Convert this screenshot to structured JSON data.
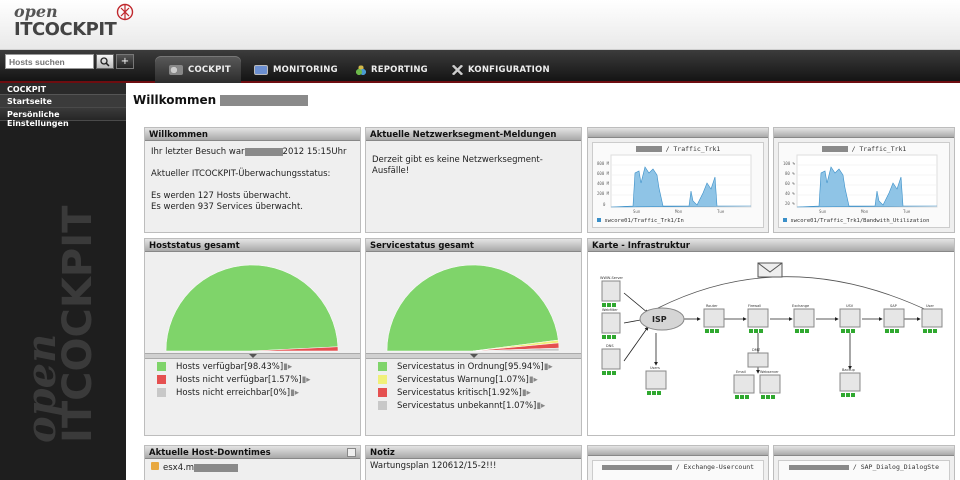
{
  "logo": {
    "open": "open",
    "itcockpit": "ITCOCKPIT"
  },
  "search": {
    "placeholder": "Hosts suchen",
    "search_icon": "search-icon",
    "add_icon": "plus-icon"
  },
  "nav": {
    "tabs": [
      {
        "label": "COCKPIT",
        "icon": "cockpit-icon"
      },
      {
        "label": "MONITORING",
        "icon": "monitor-icon"
      },
      {
        "label": "REPORTING",
        "icon": "reporting-icon"
      },
      {
        "label": "KONFIGURATION",
        "icon": "tools-icon"
      }
    ]
  },
  "sidebar": {
    "header": "COCKPIT",
    "items": [
      "Startseite",
      "Persönliche Einstellungen"
    ],
    "watermark": [
      "open",
      "ITCOCKPIT"
    ]
  },
  "page": {
    "title": "Willkommen"
  },
  "panels": {
    "welcome": {
      "title": "Willkommen",
      "last_visit_prefix": "Ihr letzter Besuch war",
      "last_visit_suffix": "2012 15:15Uhr",
      "status_heading": "Aktueller ITCOCKPIT-Überwachungsstatus:",
      "hosts_line": "Es werden 127 Hosts überwacht.",
      "services_line": "Es werden 937 Services überwacht."
    },
    "network": {
      "title": "Aktuelle Netzwerksegment-Meldungen",
      "message": "Derzeit gibt es keine Netzwerksegment-Ausfälle!"
    },
    "graph1": {
      "title": "/ Traffic_Trk1",
      "legend": "swcore01/Traffic_Trk1/In",
      "x_ticks": [
        "Sun",
        "Mon",
        "Tue"
      ],
      "y_ticks": [
        "800 M",
        "600 M",
        "400 M",
        "200 M",
        "0"
      ]
    },
    "graph2": {
      "title": "/ Traffic_Trk1",
      "legend": "swcore01/Traffic_Trk1/Bandwith_Utilization",
      "x_ticks": [
        "Sun",
        "Mon",
        "Tue"
      ],
      "y_ticks": [
        "100 %",
        "80 %",
        "60 %",
        "40 %",
        "20 %"
      ]
    },
    "hoststatus": {
      "title": "Hoststatus gesamt",
      "legend": [
        {
          "label": "Hosts verfügbar[98.43%]",
          "color": "#7fd46a",
          "value": 98.43
        },
        {
          "label": "Hosts nicht verfügbar[1.57%]",
          "color": "#e55050",
          "value": 1.57
        },
        {
          "label": "Hosts nicht erreichbar[0%]",
          "color": "#c8c8c8",
          "value": 0
        }
      ]
    },
    "servicestatus": {
      "title": "Servicestatus gesamt",
      "legend": [
        {
          "label": "Servicestatus in Ordnung[95.94%]",
          "color": "#7fd46a",
          "value": 95.94
        },
        {
          "label": "Servicestatus Warnung[1.07%]",
          "color": "#f0f07a",
          "value": 1.07
        },
        {
          "label": "Servicestatus kritisch[1.92%]",
          "color": "#e55050",
          "value": 1.92
        },
        {
          "label": "Servicestatus unbekannt[1.07%]",
          "color": "#c8c8c8",
          "value": 1.07
        }
      ]
    },
    "map": {
      "title": "Karte - Infrastruktur",
      "nodes": [
        "WWW-Server",
        "Webfilter",
        "DNS",
        "ISP",
        "Router",
        "Firewall",
        "Exchange",
        "USV",
        "SAP",
        "User",
        "DMZ",
        "Email",
        "Webserver",
        "Backup",
        "Users"
      ]
    },
    "downtimes": {
      "title": "Aktuelle Host-Downtimes",
      "item": "esx4.m"
    },
    "notiz": {
      "title": "Notiz",
      "text": "Wartungsplan 120612/15-2!!!"
    },
    "graph3": {
      "title": "/ Exchange-Usercount"
    },
    "graph4": {
      "title": "/ SAP_Dialog_DialogSte"
    }
  },
  "colors": {
    "accent": "#6e0d10",
    "ok": "#7fd46a",
    "warn": "#f0f07a",
    "crit": "#e55050",
    "unknown": "#c8c8c8"
  }
}
